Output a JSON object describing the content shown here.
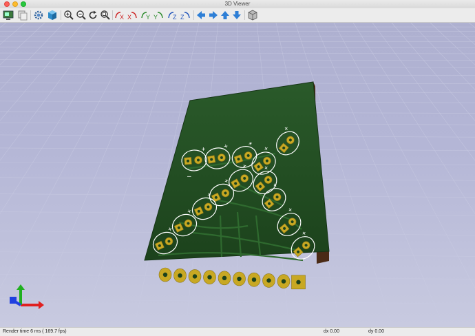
{
  "window": {
    "title": "3D Viewer"
  },
  "toolbar": {
    "tools": [
      {
        "name": "render-options-icon"
      },
      {
        "name": "copy-image-icon"
      },
      {
        "name": "preferences-gear-icon"
      },
      {
        "name": "raytracing-cube-icon"
      },
      {
        "name": "zoom-in-icon"
      },
      {
        "name": "zoom-out-icon"
      },
      {
        "name": "redraw-icon"
      },
      {
        "name": "zoom-fit-icon"
      },
      {
        "name": "rotate-x-cw-icon",
        "text": "X"
      },
      {
        "name": "rotate-x-ccw-icon",
        "text": "X"
      },
      {
        "name": "rotate-y-cw-icon",
        "text": "Y"
      },
      {
        "name": "rotate-y-ccw-icon",
        "text": "Y"
      },
      {
        "name": "rotate-z-cw-icon",
        "text": "Z"
      },
      {
        "name": "rotate-z-ccw-icon",
        "text": "Z"
      },
      {
        "name": "move-left-icon"
      },
      {
        "name": "move-right-icon"
      },
      {
        "name": "move-up-icon"
      },
      {
        "name": "move-down-icon"
      },
      {
        "name": "ortho-cube-icon"
      }
    ]
  },
  "status": {
    "render_time": "Render time 6 ms ( 169.7 fps)",
    "dx": "dx 0.00",
    "dy": "dy 0.00"
  },
  "board": {
    "pcb_color": "#1f4a1f",
    "pad_color": "#c8a823",
    "silk_color": "#ffffff",
    "plus_label": "+",
    "minus_label": "–",
    "connector_pin_count": 10
  }
}
